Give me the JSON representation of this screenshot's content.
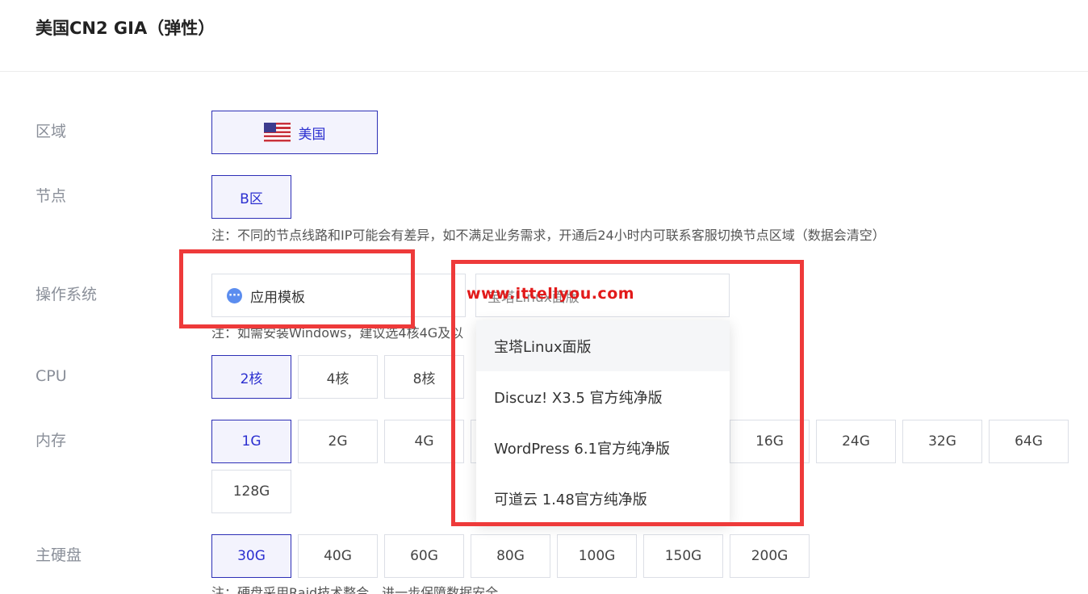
{
  "header": {
    "title": "美国CN2 GIA（弹性）"
  },
  "region": {
    "label": "区域",
    "selected": "美国",
    "flag_icon": "us-flag-icon"
  },
  "node": {
    "label": "节点",
    "selected": "B区",
    "note": "注：不同的节点线路和IP可能会有差异，如不满足业务需求，开通后24小时内可联系客服切换节点区域（数据会清空）"
  },
  "os": {
    "label": "操作系统",
    "template_label": "应用模板",
    "template_icon": "more-dots-icon",
    "select_value": "宝塔Linux面版",
    "note": "注：如需安装Windows，建议选4核4G及以",
    "watermark": "www.ittellyou.com",
    "dropdown_options": [
      "宝塔Linux面版",
      "Discuz! X3.5 官方纯净版",
      "WordPress 6.1官方纯净版",
      "可道云 1.48官方纯净版"
    ]
  },
  "cpu": {
    "label": "CPU",
    "options": [
      "2核",
      "4核",
      "8核"
    ],
    "selected": "2核"
  },
  "memory": {
    "label": "内存",
    "options": [
      "1G",
      "2G",
      "4G",
      "16G",
      "24G",
      "32G",
      "64G",
      "128G"
    ],
    "selected": "1G"
  },
  "disk": {
    "label": "主硬盘",
    "options": [
      "30G",
      "40G",
      "60G",
      "80G",
      "100G",
      "150G",
      "200G"
    ],
    "selected": "30G",
    "note": "注：硬盘采用Raid技术整合，进一步保障数据安全"
  },
  "colors": {
    "accent": "#2d2fb6",
    "highlight_red": "#ee3a3a",
    "watermark_red": "#e21a1a"
  }
}
